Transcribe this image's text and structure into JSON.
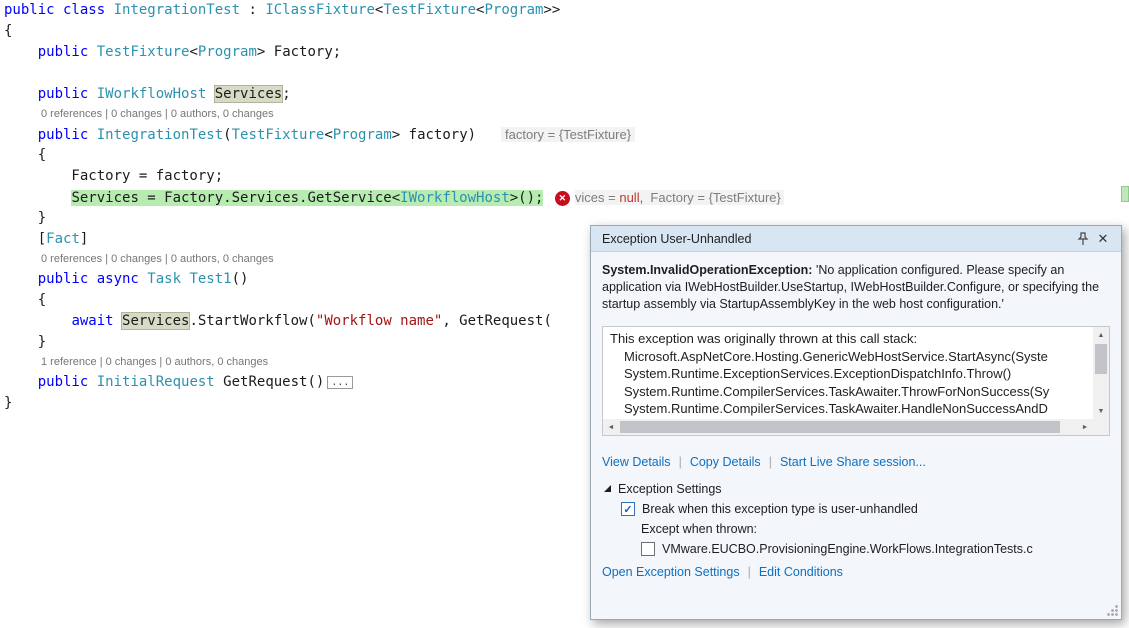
{
  "colors": {
    "keyword": "#0000ff",
    "type": "#2b91af",
    "string": "#a31515",
    "codelens_gray": "#767676",
    "statement_highlight_green": "#b7ecb0",
    "symbol_highlight": "#d6dbc6",
    "error_red": "#c50f1f",
    "link_blue": "#0e70c0",
    "popup_title_bg": "#d8e6f3",
    "popup_body_bg": "#f3f6fa"
  },
  "editor": {
    "error_icon_glyph": "✕",
    "lines": [
      {
        "kind": "code",
        "tokens": [
          {
            "t": "public class ",
            "c": "k"
          },
          {
            "t": "IntegrationTest",
            "c": "t"
          },
          {
            "t": " : ",
            "c": "p"
          },
          {
            "t": "IClassFixture",
            "c": "t"
          },
          {
            "t": "<",
            "c": "p"
          },
          {
            "t": "TestFixture",
            "c": "t"
          },
          {
            "t": "<",
            "c": "p"
          },
          {
            "t": "Program",
            "c": "t"
          },
          {
            "t": ">>",
            "c": "p"
          }
        ]
      },
      {
        "kind": "code",
        "tokens": [
          {
            "t": "{",
            "c": "p"
          }
        ]
      },
      {
        "kind": "code",
        "tokens": [
          {
            "t": "    ",
            "c": "p"
          },
          {
            "t": "public ",
            "c": "k"
          },
          {
            "t": "TestFixture",
            "c": "t"
          },
          {
            "t": "<",
            "c": "p"
          },
          {
            "t": "Program",
            "c": "t"
          },
          {
            "t": "> Factory;",
            "c": "p"
          }
        ]
      },
      {
        "kind": "code",
        "tokens": []
      },
      {
        "kind": "code",
        "tokens": [
          {
            "t": "    ",
            "c": "p"
          },
          {
            "t": "public ",
            "c": "k"
          },
          {
            "t": "IWorkflowHost ",
            "c": "t"
          },
          {
            "t": "Services",
            "c": "p boxed"
          },
          {
            "t": ";",
            "c": "p"
          }
        ]
      },
      {
        "kind": "codelens",
        "tokens": [
          {
            "t": "0 references | 0 changes | 0 authors, 0 changes",
            "c": "cl"
          }
        ]
      },
      {
        "kind": "code",
        "tokens": [
          {
            "t": "    ",
            "c": "p"
          },
          {
            "t": "public ",
            "c": "k"
          },
          {
            "t": "IntegrationTest",
            "c": "t"
          },
          {
            "t": "(",
            "c": "p"
          },
          {
            "t": "TestFixture",
            "c": "t"
          },
          {
            "t": "<",
            "c": "p"
          },
          {
            "t": "Program",
            "c": "t"
          },
          {
            "t": "> factory)",
            "c": "p"
          },
          {
            "t": "   ",
            "c": "p"
          },
          {
            "t": " factory = {TestFixture} ",
            "c": "hint"
          }
        ]
      },
      {
        "kind": "code",
        "tokens": [
          {
            "t": "    {",
            "c": "p"
          }
        ]
      },
      {
        "kind": "code",
        "tokens": [
          {
            "t": "        Factory = factory;",
            "c": "p"
          }
        ]
      },
      {
        "kind": "code",
        "tokens": [
          {
            "t": "        ",
            "c": "p"
          },
          {
            "t": "Services = Factory.Services.GetService<",
            "c": "p hl"
          },
          {
            "t": "IWorkflowHost",
            "c": "t hl"
          },
          {
            "t": ">();",
            "c": "p hl"
          },
          {
            "t": " ",
            "c": "p"
          },
          {
            "t": "",
            "c": "err"
          },
          {
            "t": "vices = ",
            "c": "hint"
          },
          {
            "t": "null,",
            "c": "hint nullv"
          },
          {
            "t": "  Factory = {TestFixture} ",
            "c": "hint"
          }
        ]
      },
      {
        "kind": "code",
        "tokens": [
          {
            "t": "    }",
            "c": "p"
          }
        ]
      },
      {
        "kind": "code",
        "tokens": [
          {
            "t": "    [",
            "c": "p"
          },
          {
            "t": "Fact",
            "c": "t"
          },
          {
            "t": "]",
            "c": "p"
          }
        ]
      },
      {
        "kind": "codelens",
        "tokens": [
          {
            "t": "0 references | 0 changes | 0 authors, 0 changes",
            "c": "cl"
          }
        ]
      },
      {
        "kind": "code",
        "tokens": [
          {
            "t": "    ",
            "c": "p"
          },
          {
            "t": "public async ",
            "c": "k"
          },
          {
            "t": "Task ",
            "c": "t"
          },
          {
            "t": "Test1",
            "c": "t"
          },
          {
            "t": "()",
            "c": "p"
          }
        ]
      },
      {
        "kind": "code",
        "tokens": [
          {
            "t": "    {",
            "c": "p"
          }
        ]
      },
      {
        "kind": "code",
        "tokens": [
          {
            "t": "        ",
            "c": "p"
          },
          {
            "t": "await ",
            "c": "k"
          },
          {
            "t": "Services",
            "c": "p boxed"
          },
          {
            "t": ".StartWorkflow(",
            "c": "p"
          },
          {
            "t": "\"Workflow name\"",
            "c": "s"
          },
          {
            "t": ", GetRequest(",
            "c": "p"
          }
        ]
      },
      {
        "kind": "code",
        "tokens": [
          {
            "t": "    }",
            "c": "p"
          }
        ]
      },
      {
        "kind": "codelens",
        "tokens": [
          {
            "t": "1 reference | 0 changes | 0 authors, 0 changes",
            "c": "cl"
          }
        ]
      },
      {
        "kind": "code",
        "tokens": [
          {
            "t": "    ",
            "c": "p"
          },
          {
            "t": "public ",
            "c": "k"
          },
          {
            "t": "InitialRequest ",
            "c": "t"
          },
          {
            "t": "GetRequest()",
            "c": "p"
          },
          {
            "t": "...",
            "c": "collapse"
          }
        ]
      },
      {
        "kind": "code",
        "tokens": [
          {
            "t": "}",
            "c": "p"
          }
        ]
      }
    ]
  },
  "popup": {
    "title": "Exception User-Unhandled",
    "title_buttons": {
      "close": "✕"
    },
    "exception_type": "System.InvalidOperationException:",
    "exception_text": " 'No application configured. Please specify an application via IWebHostBuilder.UseStartup, IWebHostBuilder.Configure, or specifying the startup assembly via StartupAssemblyKey in the web host configuration.'",
    "callstack": {
      "header": "This exception was originally thrown at this call stack:",
      "frames": [
        "Microsoft.AspNetCore.Hosting.GenericWebHostService.StartAsync(Syste",
        "System.Runtime.ExceptionServices.ExceptionDispatchInfo.Throw()",
        "System.Runtime.CompilerServices.TaskAwaiter.ThrowForNonSuccess(Sy",
        "System.Runtime.CompilerServices.TaskAwaiter.HandleNonSuccessAndD"
      ],
      "scroll_glyphs": {
        "up": "▲",
        "down": "▼",
        "left": "◄",
        "right": "►"
      }
    },
    "links": {
      "view_details": "View Details",
      "copy_details": "Copy Details",
      "live_share": "Start Live Share session...",
      "separator": "|"
    },
    "settings": {
      "header": "Exception Settings",
      "checkmark": "✓",
      "break_label": "Break when this exception type is user-unhandled",
      "break_checked": true,
      "except_label": "Except when thrown:",
      "except_item": "VMware.EUCBO.ProvisioningEngine.WorkFlows.IntegrationTests.c",
      "except_checked": false,
      "open_settings": "Open Exception Settings",
      "edit_conditions": "Edit Conditions"
    }
  }
}
